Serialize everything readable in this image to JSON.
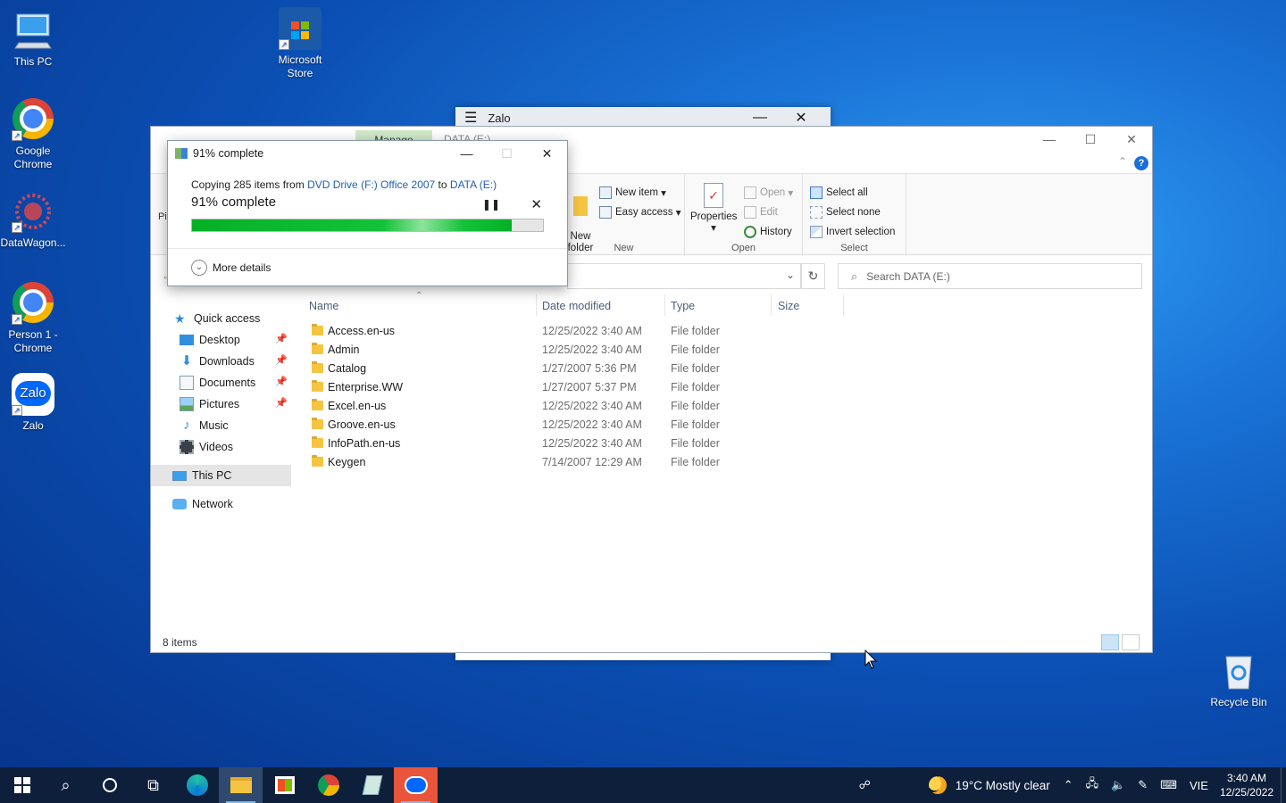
{
  "desktop": {
    "icons": [
      {
        "label": "This PC",
        "icon": "this-pc-icon"
      },
      {
        "label": "Microsoft Store",
        "icon": "microsoft-store-icon"
      },
      {
        "label": "Google Chrome",
        "icon": "chrome-icon"
      },
      {
        "label": "DataWagon...",
        "icon": "datawagon-icon"
      },
      {
        "label": "Person 1 - Chrome",
        "icon": "chrome-profile-icon"
      },
      {
        "label": "Zalo",
        "icon": "zalo-icon"
      },
      {
        "label": "Recycle Bin",
        "icon": "recycle-bin-icon"
      }
    ]
  },
  "zalo_window": {
    "title": "Zalo"
  },
  "explorer": {
    "title": "DATA (E:)",
    "manage_tab": "Manage",
    "ribbon_partial_label": "Pi",
    "ribbon": {
      "new_group": {
        "name": "New",
        "new_folder": "New\nfolder",
        "new_item": "New item",
        "easy_access": "Easy access"
      },
      "open_group": {
        "name": "Open",
        "properties": "Properties",
        "open": "Open",
        "edit": "Edit",
        "history": "History"
      },
      "select_group": {
        "name": "Select",
        "select_all": "Select all",
        "select_none": "Select none",
        "invert_selection": "Invert selection"
      }
    },
    "search_placeholder": "Search DATA (E:)",
    "nav": {
      "quick_access": "Quick access",
      "desktop": "Desktop",
      "downloads": "Downloads",
      "documents": "Documents",
      "pictures": "Pictures",
      "music": "Music",
      "videos": "Videos",
      "this_pc": "This PC",
      "network": "Network"
    },
    "columns": {
      "name": "Name",
      "date_modified": "Date modified",
      "type": "Type",
      "size": "Size"
    },
    "files": [
      {
        "name": "Access.en-us",
        "date": "12/25/2022 3:40 AM",
        "type": "File folder"
      },
      {
        "name": "Admin",
        "date": "12/25/2022 3:40 AM",
        "type": "File folder"
      },
      {
        "name": "Catalog",
        "date": "1/27/2007 5:36 PM",
        "type": "File folder"
      },
      {
        "name": "Enterprise.WW",
        "date": "1/27/2007 5:37 PM",
        "type": "File folder"
      },
      {
        "name": "Excel.en-us",
        "date": "12/25/2022 3:40 AM",
        "type": "File folder"
      },
      {
        "name": "Groove.en-us",
        "date": "12/25/2022 3:40 AM",
        "type": "File folder"
      },
      {
        "name": "InfoPath.en-us",
        "date": "12/25/2022 3:40 AM",
        "type": "File folder"
      },
      {
        "name": "Keygen",
        "date": "7/14/2007 12:29 AM",
        "type": "File folder"
      }
    ],
    "status_items": "8 items"
  },
  "copy_dialog": {
    "title": "91% complete",
    "line_prefix": "Copying 285 items from ",
    "source": "DVD Drive (F:) Office 2007",
    "line_to": " to ",
    "destination": "DATA (E:)",
    "percent_text": "91% complete",
    "progress": 0.91,
    "more_details": "More details"
  },
  "taskbar": {
    "weather": "19°C  Mostly clear",
    "language": "VIE",
    "time": "3:40 AM",
    "date": "12/25/2022"
  },
  "colors": {
    "accent": "#0078d7",
    "progress": "#06b025",
    "taskbar": "#0d1f3a"
  }
}
